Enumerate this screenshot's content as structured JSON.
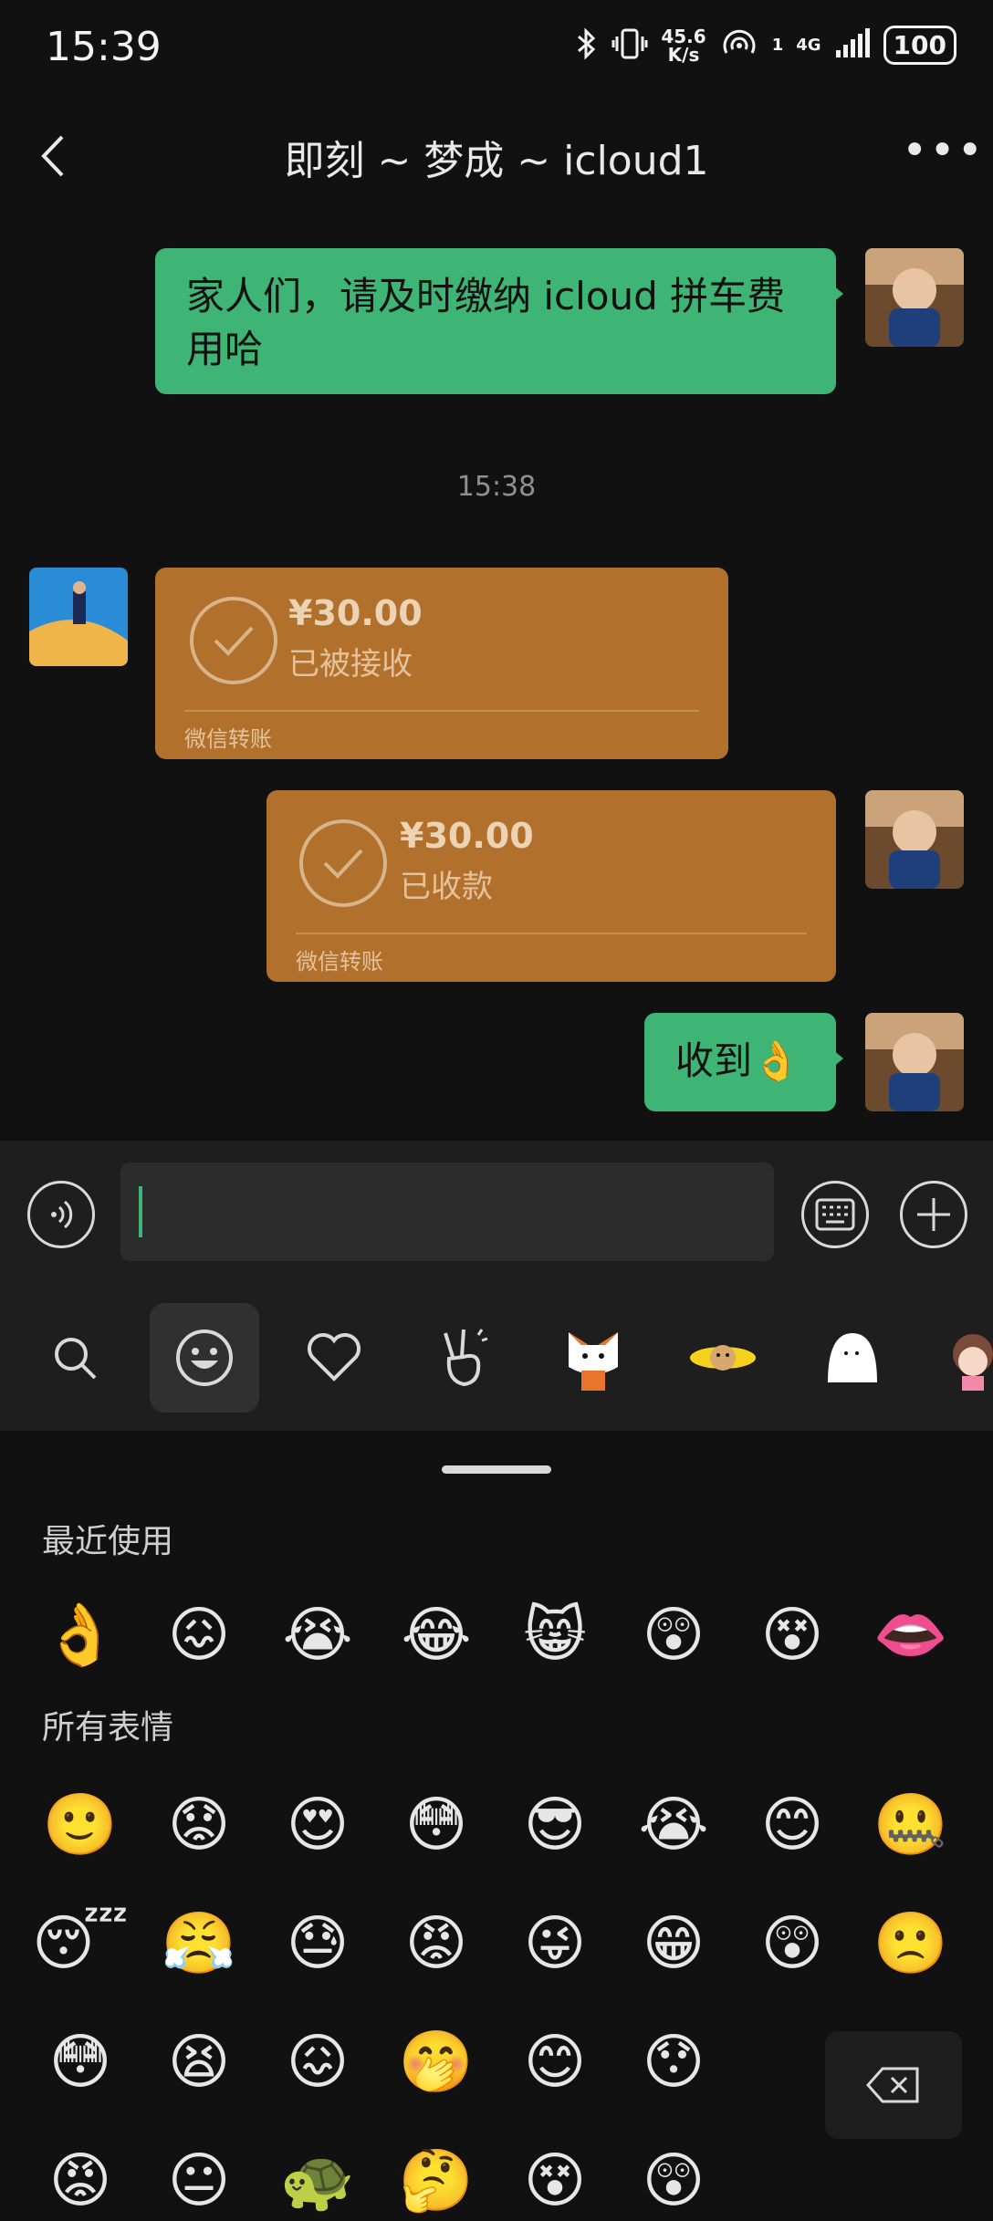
{
  "status_bar": {
    "time": "15:39",
    "net_speed_value": "45.6",
    "net_speed_unit": "K/s",
    "signal_label": "4G",
    "sim_index": "1",
    "battery": "100"
  },
  "header": {
    "title": "即刻 ~ 梦成 ~ icloud1"
  },
  "messages": {
    "msg1_text": "家人们，请及时缴纳 icloud 拼车费用哈",
    "timestamp": "15:38",
    "transfer1_amount": "¥30.00",
    "transfer1_status": "已被接收",
    "transfer1_footer": "微信转账",
    "transfer2_amount": "¥30.00",
    "transfer2_status": "已收款",
    "transfer2_footer": "微信转账",
    "msg2_text": "收到👌"
  },
  "emoji_panel": {
    "recent_title": "最近使用",
    "all_title": "所有表情",
    "recent": [
      "👌",
      "😖",
      "😭",
      "😂",
      "😸",
      "😲",
      "😵",
      "👄"
    ],
    "all_row1": [
      "🙂",
      "😟",
      "😍",
      "😳",
      "😎",
      "😭",
      "😊",
      "🤐"
    ],
    "all_row2": [
      "😴",
      "😤",
      "😓",
      "😡",
      "😜",
      "😁",
      "😲",
      "🙁"
    ],
    "all_row3": [
      "😳",
      "😫",
      "😖",
      "🤭",
      "😊",
      "😯"
    ],
    "all_row4": [
      "😡",
      "😐",
      "🐢",
      "🤔",
      "😵",
      "😲"
    ]
  },
  "colors": {
    "bg": "#111111",
    "bubble_green": "#3eb575",
    "transfer_brown": "#b1712c",
    "input_bar": "#1e1e1e"
  }
}
